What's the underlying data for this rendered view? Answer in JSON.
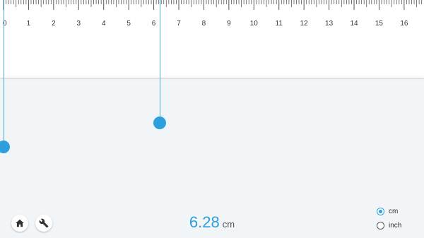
{
  "ruler": {
    "unit": "cm",
    "max_value": 16.9,
    "labels": [
      "0",
      "1",
      "2",
      "3",
      "4",
      "5",
      "6",
      "7",
      "8",
      "9",
      "10",
      "11",
      "12",
      "13",
      "14",
      "15",
      "16"
    ]
  },
  "handles": {
    "left_cm": 0,
    "right_cm": 6.28
  },
  "measurement": {
    "value": "6.28",
    "unit": "cm"
  },
  "toolbar": {
    "home_icon": "home-icon",
    "settings_icon": "wrench-icon"
  },
  "units": {
    "selected": "cm",
    "options": [
      {
        "label": "cm",
        "selected": true
      },
      {
        "label": "inch",
        "selected": false
      }
    ]
  },
  "colors": {
    "accent": "#2d9fdc",
    "background": "#f1f5f7",
    "ruler": "#ffffff"
  }
}
